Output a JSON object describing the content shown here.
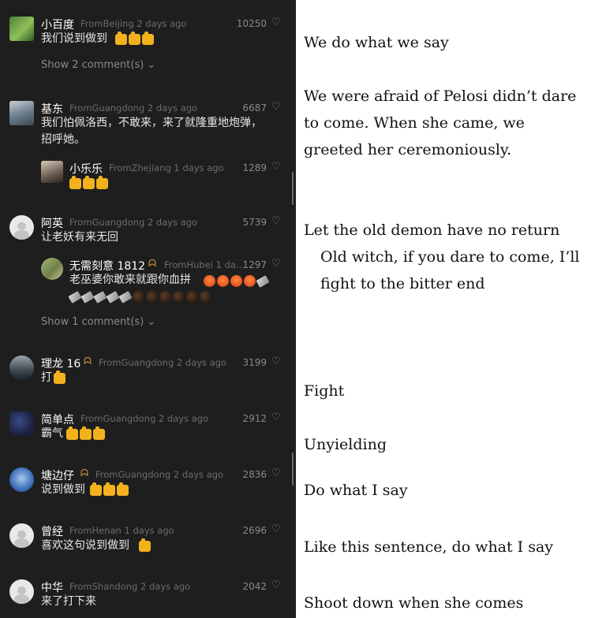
{
  "comments": [
    {
      "name": "小百度",
      "location": "FromBeijing",
      "time": "2 days ago",
      "likes": "10250",
      "text": "我们说到做到",
      "show": "Show 2 comment(s)"
    },
    {
      "name": "基东",
      "location": "FromGuangdong",
      "time": "2 days ago",
      "likes": "6687",
      "text_line1": "我们怕佩洛西，不敢来，来了就隆重地炮弹，",
      "text_line2": "招呼她。"
    },
    {
      "name": "小乐乐",
      "location": "FromZhejiang",
      "time": "1 days ago",
      "likes": "1289"
    },
    {
      "name": "阿英",
      "location": "FromGuangdong",
      "time": "2 days ago",
      "likes": "5739",
      "text": "让老妖有来无回"
    },
    {
      "name": "无需刻意 1812",
      "location": "FromHubei",
      "time": "1 da...",
      "likes": "1297",
      "text": "老巫婆你敢来就跟你血拼",
      "show": "Show 1 comment(s)"
    },
    {
      "name": "理龙 16",
      "location": "FromGuangdong",
      "time": "2 days ago",
      "likes": "3199",
      "text": "打"
    },
    {
      "name": "简单点",
      "location": "FromGuangdong",
      "time": "2 days ago",
      "likes": "2912",
      "text": "霸气"
    },
    {
      "name": "塘边仔",
      "location": "FromGuangdong",
      "time": "2 days ago",
      "likes": "2836",
      "text": "说到做到"
    },
    {
      "name": "曾经",
      "location": "FromHenan",
      "time": "1 days ago",
      "likes": "2696",
      "text": "喜欢这句说到做到"
    },
    {
      "name": "中华",
      "location": "FromShandong",
      "time": "2 days ago",
      "likes": "2042",
      "text": "来了打下来"
    }
  ],
  "icons": {
    "heart": "heart-icon",
    "chevron": "chevron-down-icon",
    "vip": "vip-badge-icon"
  },
  "translations": {
    "t1": "We do what we say",
    "t2a": "We were afraid of Pelosi didn’t dare",
    "t2b": "to come. When she came, we",
    "t2c": "greeted her ceremoniously.",
    "t3": "Let the old demon have no return",
    "t4a": "Old witch, if you dare to come, I’ll",
    "t4b": "fight to the bitter end",
    "t5": "Fight",
    "t6": "Unyielding",
    "t7": "Do what I say",
    "t8": "Like this sentence, do what I say",
    "t9": "Shoot down when she comes"
  },
  "colors": {
    "panel_bg": "#1e1e1e",
    "name": "#ffffff",
    "meta": "#6c6c6c",
    "vip": "#d6a23a",
    "emoji_thumb": "#f2b11d"
  }
}
